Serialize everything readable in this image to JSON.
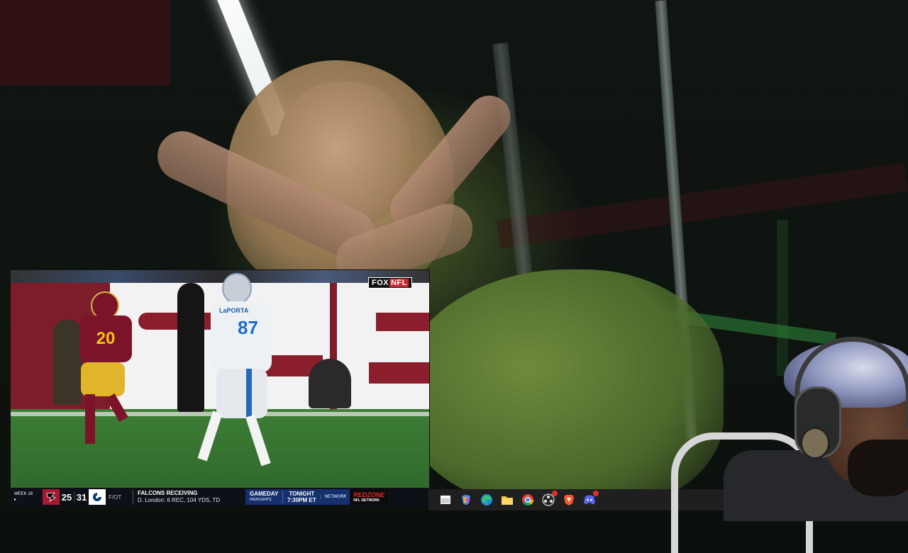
{
  "stream": {
    "network_bug": "FOX",
    "network_bug_suffix": "NFL",
    "player_jersey_away": "20",
    "player_jersey_home": "87",
    "player_name_home": "LaPORTA"
  },
  "ticker": {
    "week_label": "WEEK 18",
    "week_sub": "▸",
    "team_a_logo": "falcons-logo",
    "team_a_score": "25",
    "team_b_score": "31",
    "team_b_logo": "colts-logo",
    "game_status": "F/OT",
    "stat_title": "FALCONS RECEIVING",
    "stat_detail": "D. London: 6 REC, 104 YDS, TD",
    "promo_gameday": "GAMEDAY",
    "promo_gameday_sub": "HIGHLIGHTS",
    "promo_tonight": "TONIGHT",
    "promo_time": "7:30PM ET",
    "promo_network": "NETWORK",
    "redzone": "REDZONE",
    "redzone_sub": "NFL NETWORK",
    "colors": {
      "falcons": "#a71930",
      "colts": "#ffffff",
      "promo_bg": "#15306e",
      "redzone": "#e32a2a"
    }
  },
  "taskbar": {
    "icons": [
      "window-icon",
      "copilot-icon",
      "edge-icon",
      "folder-icon",
      "chrome-icon",
      "obs-icon",
      "brave-icon",
      "discord-icon"
    ]
  }
}
